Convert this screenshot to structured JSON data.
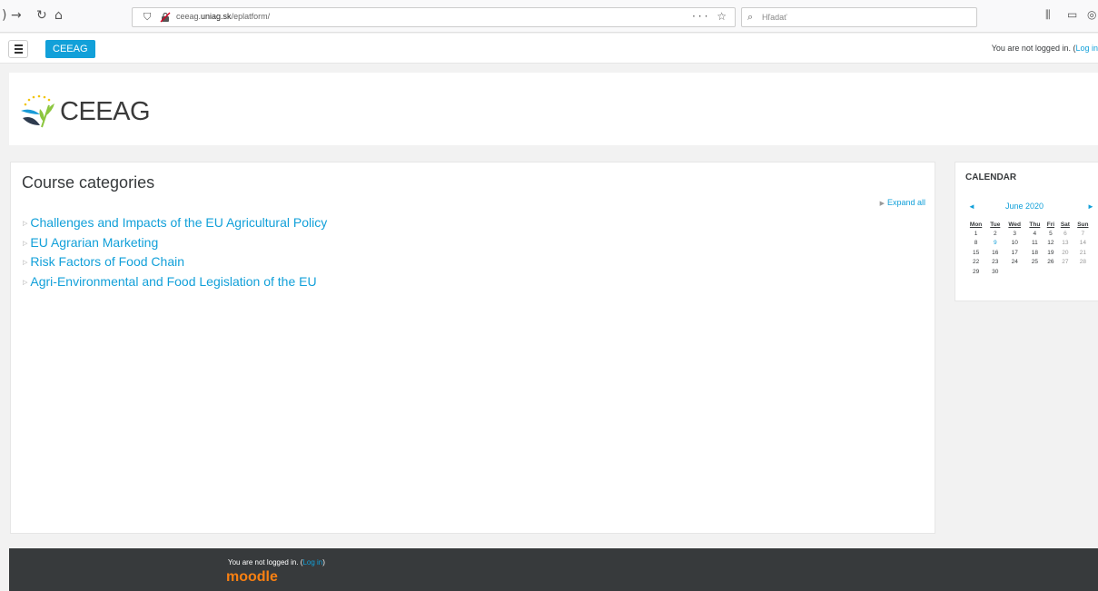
{
  "browser": {
    "url_prefix": "ceeag.",
    "url_domain": "uniag.sk",
    "url_path": "/eplatform/",
    "url_actions": "··· ☆",
    "search_placeholder": "Hľadať"
  },
  "navbar": {
    "brand_label": "CEEAG",
    "login_text": "You are not logged in. (",
    "login_link": "Log in"
  },
  "header": {
    "logo_text": "CEEAG"
  },
  "main": {
    "title": "Course categories",
    "expand_all": "Expand all",
    "categories": [
      "Challenges and Impacts of the EU Agricultural Policy",
      "EU Agrarian Marketing",
      "Risk Factors of Food Chain",
      "Agri-Environmental and Food Legislation of the EU"
    ]
  },
  "calendar": {
    "title": "CALENDAR",
    "prev": "◄",
    "next": "►",
    "month": "June 2020",
    "days": [
      "Mon",
      "Tue",
      "Wed",
      "Thu",
      "Fri",
      "Sat",
      "Sun"
    ],
    "weeks": [
      [
        "1",
        "2",
        "3",
        "4",
        "5",
        "6",
        "7"
      ],
      [
        "8",
        "9",
        "10",
        "11",
        "12",
        "13",
        "14"
      ],
      [
        "15",
        "16",
        "17",
        "18",
        "19",
        "20",
        "21"
      ],
      [
        "22",
        "23",
        "24",
        "25",
        "26",
        "27",
        "28"
      ],
      [
        "29",
        "30",
        "",
        "",
        "",
        "",
        ""
      ]
    ],
    "today": "9"
  },
  "footer": {
    "login_text": "You are not logged in. (",
    "login_link": "Log in",
    "login_close": ")",
    "moodle_logo": "moodle"
  },
  "colors": {
    "accent": "#12a0d9",
    "footer_bg": "#373a3c",
    "moodle_orange": "#f98012"
  }
}
